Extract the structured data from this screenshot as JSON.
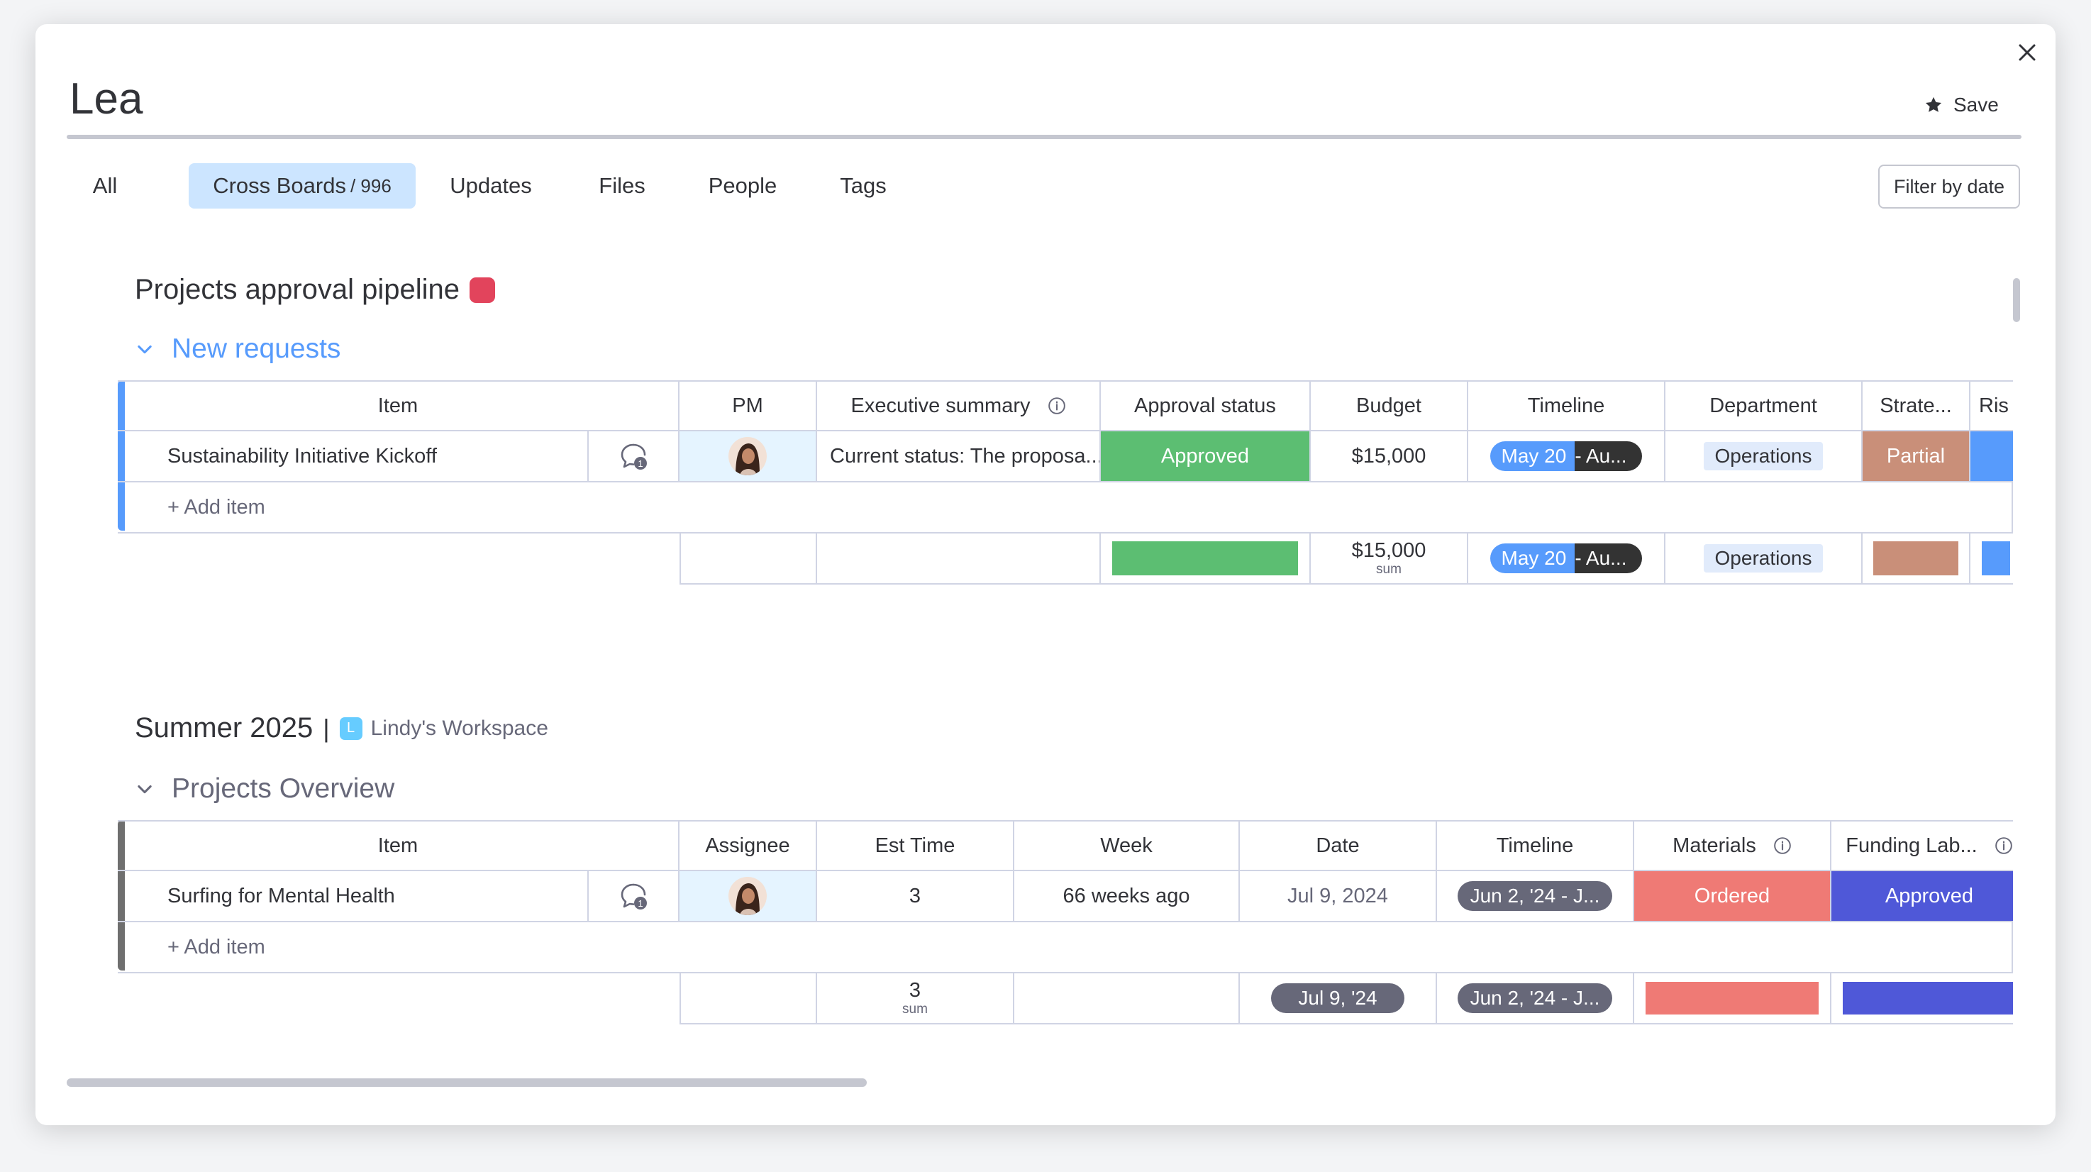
{
  "header": {
    "title": "Lea",
    "save_label": "Save",
    "filter_label": "Filter by date"
  },
  "tabs": [
    {
      "label": "All"
    },
    {
      "label": "Cross Boards",
      "count": "/ 996"
    },
    {
      "label": "Updates"
    },
    {
      "label": "Files"
    },
    {
      "label": "People"
    },
    {
      "label": "Tags"
    }
  ],
  "colors": {
    "board_dot": "#e2445c",
    "approved_green": "#5cbe72",
    "partial_brown": "#c98f79",
    "risk_blue": "#579bfc",
    "ordered_red": "#ef7a75",
    "funding_purple": "#4f58d8",
    "group1_bar": "#579bfc",
    "group2_bar": "#6f6f6f"
  },
  "board1": {
    "title": "Projects approval pipeline",
    "group": {
      "name": "New requests",
      "columns": [
        "Item",
        "PM",
        "Executive summary",
        "Approval status",
        "Budget",
        "Timeline",
        "Department",
        "Strate...",
        "Ris"
      ],
      "row": {
        "item": "Sustainability Initiative Kickoff",
        "comments_count": "1",
        "exec_summary": "Current status: The proposa...",
        "approval_status": "Approved",
        "budget": "$15,000",
        "timeline_start": "May 20",
        "timeline_end": "- Au...",
        "department": "Operations",
        "strategy": "Partial"
      },
      "add_item": "+ Add item",
      "summary": {
        "budget": "$15,000",
        "budget_sub": "sum",
        "timeline_start": "May 20",
        "timeline_end": "- Au...",
        "department": "Operations"
      }
    }
  },
  "board2": {
    "title": "Summer 2025",
    "separator": "|",
    "workspace_badge": "L",
    "workspace": "Lindy's Workspace",
    "group": {
      "name": "Projects Overview",
      "columns": [
        "Item",
        "Assignee",
        "Est Time",
        "Week",
        "Date",
        "Timeline",
        "Materials",
        "Funding Lab..."
      ],
      "row": {
        "item": "Surfing for Mental Health",
        "comments_count": "1",
        "est_time": "3",
        "week": "66 weeks ago",
        "date": "Jul 9, 2024",
        "timeline": "Jun 2, '24 - J...",
        "materials": "Ordered",
        "funding": "Approved"
      },
      "add_item": "+ Add item",
      "summary": {
        "est_time": "3",
        "est_time_sub": "sum",
        "date": "Jul 9, '24",
        "timeline": "Jun 2, '24 - J..."
      }
    }
  }
}
